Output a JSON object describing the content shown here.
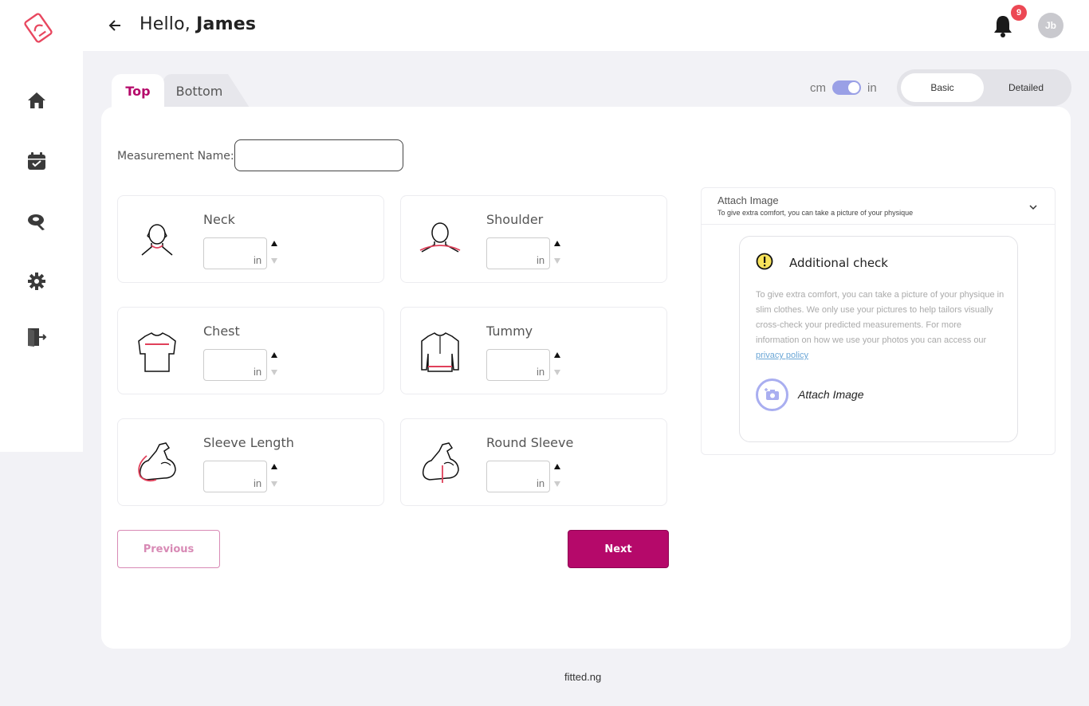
{
  "header": {
    "greeting_prefix": "Hello,",
    "user_name": "James",
    "notification_count": "9",
    "avatar_initials": "Jb"
  },
  "sidebar": {
    "items": [
      {
        "icon": "home-icon"
      },
      {
        "icon": "calendar-check-icon"
      },
      {
        "icon": "measuring-tape-icon"
      },
      {
        "icon": "gear-icon"
      },
      {
        "icon": "logout-icon"
      }
    ]
  },
  "tabs": [
    {
      "label": "Top",
      "active": true
    },
    {
      "label": "Bottom",
      "active": false
    }
  ],
  "units": {
    "left": "cm",
    "right": "in",
    "selected": "in"
  },
  "mode": {
    "basic": "Basic",
    "detailed": "Detailed",
    "selected": "Basic"
  },
  "form": {
    "measurement_name_label": "Measurement Name:",
    "measurement_name_value": "",
    "fields": [
      {
        "label": "Neck",
        "unit": "in",
        "value": ""
      },
      {
        "label": "Shoulder",
        "unit": "in",
        "value": ""
      },
      {
        "label": "Chest",
        "unit": "in",
        "value": ""
      },
      {
        "label": "Tummy",
        "unit": "in",
        "value": ""
      },
      {
        "label": "Sleeve Length",
        "unit": "in",
        "value": ""
      },
      {
        "label": "Round Sleeve",
        "unit": "in",
        "value": ""
      }
    ],
    "previous_label": "Previous",
    "next_label": "Next"
  },
  "attach": {
    "title": "Attach Image",
    "subtitle": "To give extra comfort, you can take a picture of your physique",
    "check_title": "Additional check",
    "check_text": "To give extra comfort, you can take a picture of your physique in slim clothes. We only use your pictures to help tailors visually cross-check your predicted measurements. For more information on how we use your photos you can access our",
    "privacy_link": "privacy policy",
    "button_label": "Attach Image"
  },
  "footer": {
    "text": "fitted.ng"
  },
  "colors": {
    "brand": "#b5096a",
    "accent": "#9aa0e6",
    "badge": "#ec4854"
  }
}
